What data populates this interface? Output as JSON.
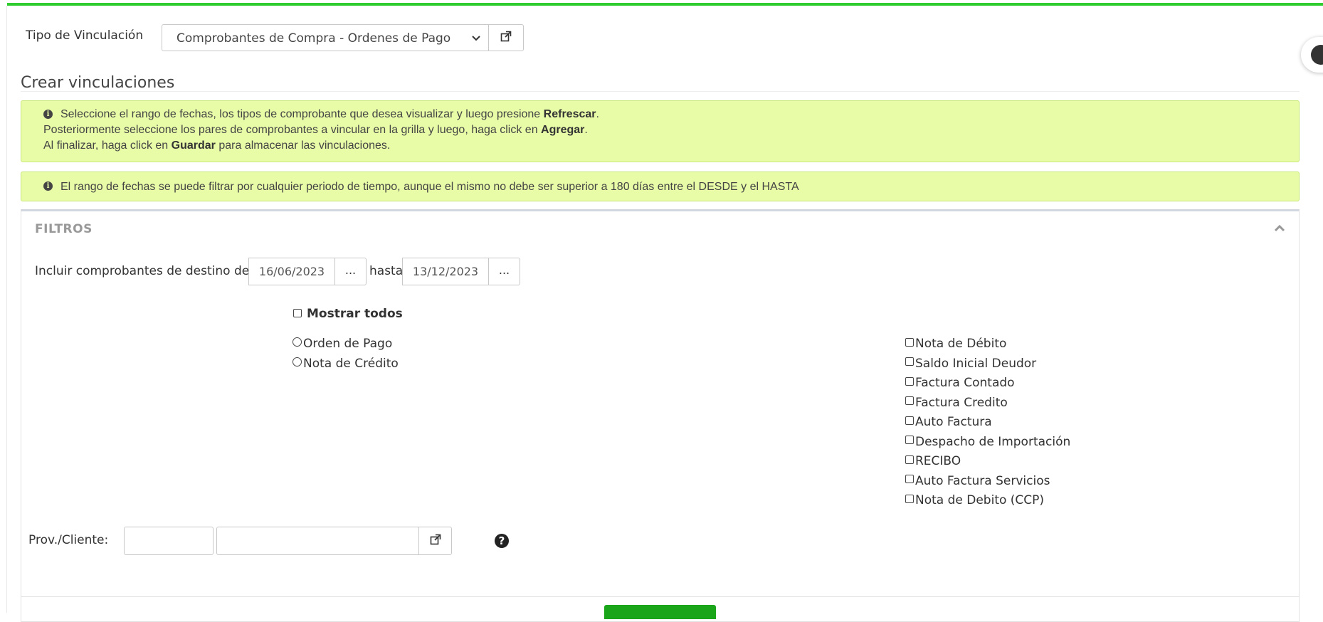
{
  "header": {
    "tipo_label": "Tipo de Vinculación",
    "tipo_value": "Comprobantes de Compra - Ordenes de Pago"
  },
  "section_title": "Crear vinculaciones",
  "alerts": {
    "line1_pre": "Seleccione el rango de fechas, los tipos de comprobante que desea visualizar y luego presione ",
    "line1_bold": "Refrescar",
    "line1_post": ".",
    "line2_pre": "Posteriormente seleccione los pares de comprobantes a vincular en la grilla y luego, haga click en ",
    "line2_bold": "Agregar",
    "line2_post": ".",
    "line3_pre": "Al finalizar, haga click en ",
    "line3_bold": "Guardar",
    "line3_post": " para almacenar las vinculaciones.",
    "date_range_note": "El rango de fechas se puede filtrar por cualquier periodo de tiempo, aunque el mismo no debe ser superior a 180 días entre el DESDE y el HASTA"
  },
  "filters": {
    "title": "FILTROS",
    "desde_label": "Incluir comprobantes de destino desde",
    "desde_value": "16/06/2023",
    "picker_label": "...",
    "hasta_label": "hasta",
    "hasta_value": "13/12/2023",
    "mostrar_todos": "Mostrar todos",
    "radios": [
      "Orden de Pago",
      "Nota de Crédito"
    ],
    "checkboxes": [
      "Nota de Débito",
      "Saldo Inicial Deudor",
      "Factura Contado",
      "Factura Credito",
      "Auto Factura",
      "Despacho de Importación",
      "RECIBO",
      "Auto Factura Servicios",
      "Nota de Debito (CCP)"
    ],
    "prov_label": "Prov./Cliente:",
    "prov_code": "",
    "prov_name": "",
    "help_glyph": "?"
  },
  "colors": {
    "accent_green": "#2ecc2e",
    "alert_bg": "#e8fca8",
    "button_green": "#1aa51a"
  }
}
